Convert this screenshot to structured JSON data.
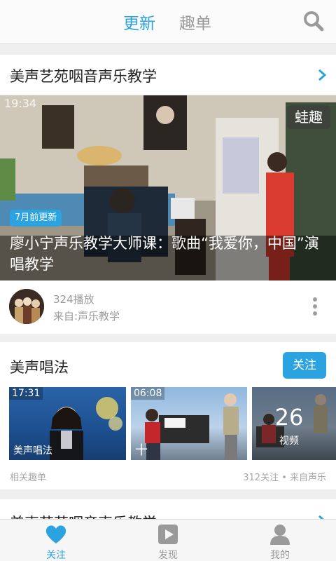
{
  "header": {
    "tabs": [
      "更新",
      "趣单"
    ],
    "active_tab": 0,
    "search_icon": "search-icon"
  },
  "feed_card": {
    "title": "美声艺苑咽音声乐教学",
    "video": {
      "duration": "19:34",
      "brand_tag": "蛙趣",
      "update_badge": "7月前更新",
      "title": "廖小宁声乐教学大师课：歌曲“我爱你，中国”演唱教学"
    },
    "plays": "324播放",
    "source": "来自:声乐教学"
  },
  "topic_card": {
    "title": "美声唱法",
    "follow_label": "关注",
    "thumbs": [
      {
        "duration": "17:31",
        "label": "美声唱法"
      },
      {
        "duration": "06:08",
        "label": "十"
      },
      {
        "count": "26",
        "count_label": "视频"
      }
    ],
    "footer_left": "相关趣单",
    "footer_right": "312关注 • 来自声乐"
  },
  "next_card": {
    "title": "美声艺苑咽音声乐教学"
  },
  "bottom_nav": {
    "items": [
      {
        "label": "关注",
        "icon": "heart-icon"
      },
      {
        "label": "发现",
        "icon": "play-icon"
      },
      {
        "label": "我的",
        "icon": "user-icon"
      }
    ],
    "active": 0
  },
  "colors": {
    "accent": "#2aa3e0",
    "muted_text": "#9a9a9a",
    "background": "#efefef"
  }
}
